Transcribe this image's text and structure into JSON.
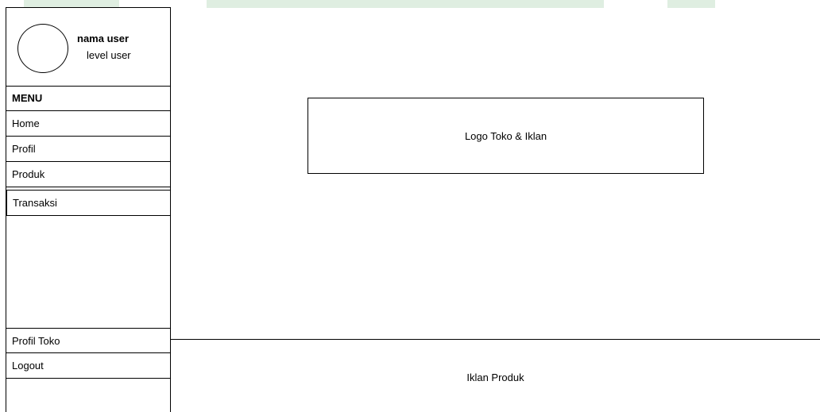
{
  "user": {
    "name": "nama user",
    "level": "level user"
  },
  "menu": {
    "title": "MENU",
    "items": [
      {
        "label": "Home"
      },
      {
        "label": "Profil"
      },
      {
        "label": "Produk"
      },
      {
        "label": "Transaksi"
      }
    ],
    "bottom_items": [
      {
        "label": "Profil Toko"
      },
      {
        "label": "Logout"
      }
    ]
  },
  "main": {
    "banner_label": "Logo Toko & Iklan",
    "footer_label": "Iklan Produk"
  },
  "colors": {
    "border": "#000000",
    "background": "#ffffff",
    "top_strip": "#dfeee1"
  }
}
